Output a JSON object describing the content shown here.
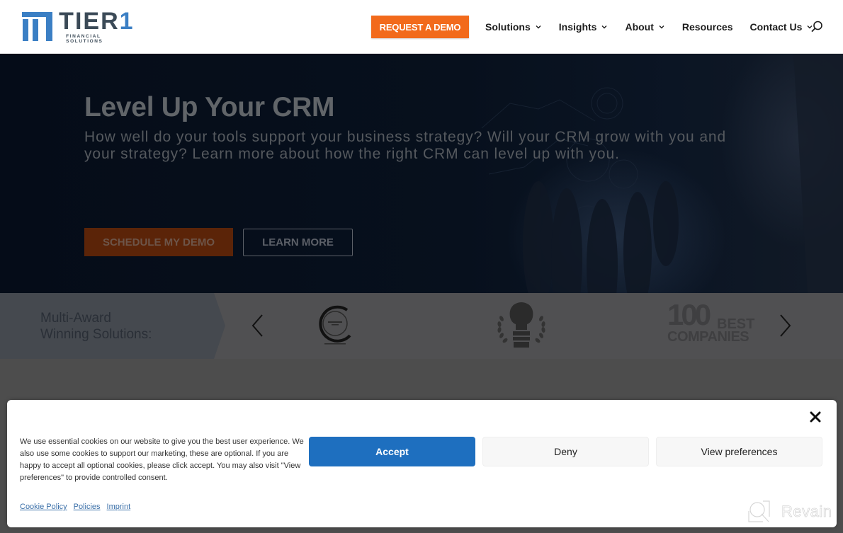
{
  "header": {
    "logo": {
      "name": "TIER1",
      "name_main": "TIER",
      "name_digit": "1",
      "tagline": "FINANCIAL SOLUTIONS"
    },
    "cta_label": "REQUEST A DEMO",
    "nav": [
      {
        "label": "Solutions",
        "has_dropdown": true
      },
      {
        "label": "Insights",
        "has_dropdown": true
      },
      {
        "label": "About",
        "has_dropdown": true
      },
      {
        "label": "Resources",
        "has_dropdown": false
      },
      {
        "label": "Contact Us",
        "has_dropdown": true
      }
    ],
    "search_icon": "search-icon"
  },
  "hero": {
    "title": "Level Up Your CRM",
    "subtitle": "How well do your tools support your business strategy? Will your CRM grow with you and your strategy? Learn more about how the right CRM can level up with you.",
    "primary_button": "SCHEDULE MY DEMO",
    "secondary_button": "LEARN MORE"
  },
  "awards": {
    "label_line1": "Multi-Award",
    "label_line2": "Winning Solutions:",
    "prev_icon": "chevron-left-icon",
    "next_icon": "chevron-right-icon",
    "badges": [
      {
        "name": "circular-award-badge"
      },
      {
        "name": "laurel-winner-badge"
      },
      {
        "name": "100-best-companies-badge",
        "number": "100",
        "word1": "BEST",
        "word2": "COMPANIES"
      }
    ]
  },
  "cookie_banner": {
    "text": "We use essential cookies on our website to give you the best user experience. We also use some cookies to support our marketing, these are optional. If you are happy to accept all optional cookies, please click accept. You may also visit \"View preferences\" to provide controlled consent.",
    "links": [
      "Cookie Policy",
      "Policies",
      "Imprint"
    ],
    "buttons": {
      "accept": "Accept",
      "deny": "Deny",
      "preferences": "View preferences"
    },
    "close_icon": "close-icon"
  },
  "watermark": {
    "text": "Revain"
  },
  "colors": {
    "brand_blue": "#3b7fc4",
    "brand_orange": "#f26a1b",
    "accept_blue": "#1e6fbf",
    "logo_text": "#3b4a57"
  }
}
